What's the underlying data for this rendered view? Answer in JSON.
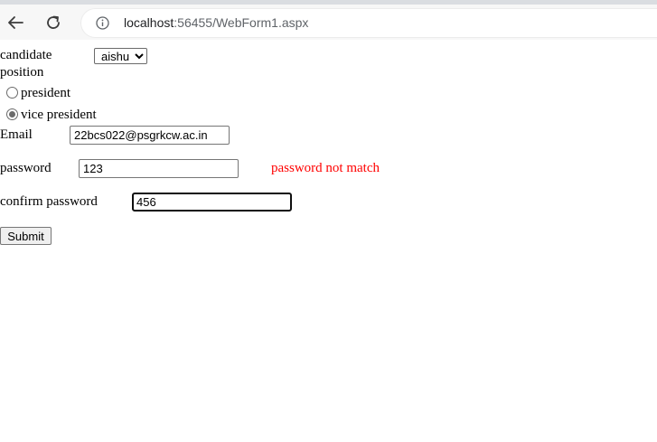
{
  "browser": {
    "url_host": "localhost",
    "url_rest": ":56455/WebForm1.aspx",
    "icons": {
      "back": "arrow-left-icon",
      "reload": "reload-icon",
      "info": "info-icon"
    }
  },
  "form": {
    "candidate_label_line1": "candidate",
    "candidate_label_line2": "position",
    "candidate_selected": "aishu",
    "radio_president_label": "president",
    "radio_vice_label": "vice president",
    "radio_selected": "vice president",
    "email_label": "Email",
    "email_value": "22bcs022@psgrkcw.ac.in",
    "password_label": "password",
    "password_value": "123",
    "password_error": "password not match",
    "confirm_label": "confirm password",
    "confirm_value": "456",
    "submit_label": "Submit"
  },
  "colors": {
    "error": "#ff0000",
    "toolbar": "#f7f7f7"
  }
}
